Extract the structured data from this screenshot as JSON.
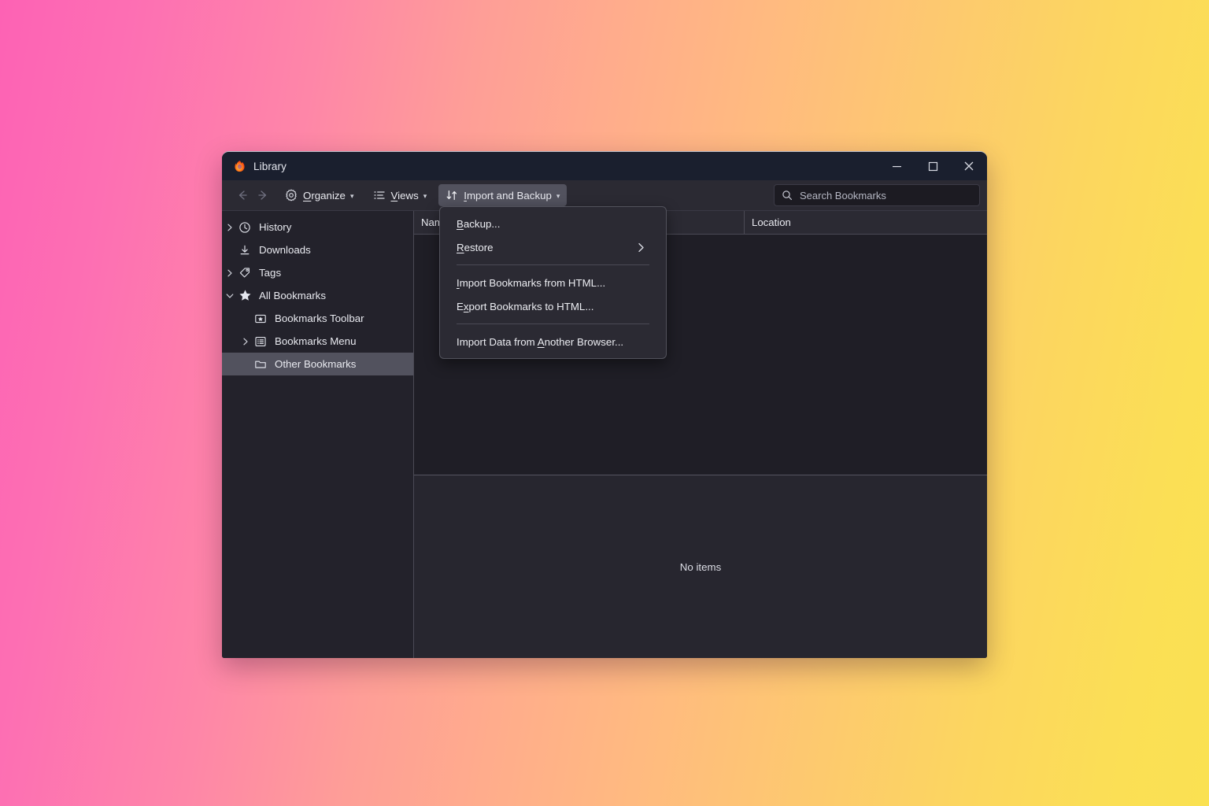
{
  "window": {
    "title": "Library",
    "logo_icon": "firefox-logo-icon",
    "controls": {
      "minimize_icon": "minimize-icon",
      "maximize_icon": "maximize-icon",
      "close_icon": "close-icon"
    }
  },
  "toolbar": {
    "back_icon": "back-arrow-icon",
    "forward_icon": "forward-arrow-icon",
    "buttons": [
      {
        "label": "Organize",
        "accesskey": "O",
        "icon": "gear-icon",
        "caret": "⌄",
        "active": false
      },
      {
        "label": "Views",
        "accesskey": "V",
        "icon": "list-view-icon",
        "caret": "⌄",
        "active": false
      },
      {
        "label": "Import and Backup",
        "accesskey": "I",
        "icon": "import-export-arrows-icon",
        "caret": "⌄",
        "active": true
      }
    ],
    "search": {
      "placeholder": "Search Bookmarks",
      "value": "",
      "icon": "search-icon"
    }
  },
  "sidebar": {
    "items": [
      {
        "label": "History",
        "icon": "clock-icon",
        "twisty": "collapsed",
        "indent": 0,
        "selected": false
      },
      {
        "label": "Downloads",
        "icon": "download-icon",
        "twisty": "none",
        "indent": 0,
        "selected": false
      },
      {
        "label": "Tags",
        "icon": "tag-icon",
        "twisty": "collapsed",
        "indent": 0,
        "selected": false
      },
      {
        "label": "All Bookmarks",
        "icon": "star-icon",
        "twisty": "expanded",
        "indent": 0,
        "selected": false
      },
      {
        "label": "Bookmarks Toolbar",
        "icon": "bookmarks-toolbar-icon",
        "twisty": "none",
        "indent": 1,
        "selected": false
      },
      {
        "label": "Bookmarks Menu",
        "icon": "bookmarks-menu-icon",
        "twisty": "collapsed",
        "indent": 1,
        "selected": false
      },
      {
        "label": "Other Bookmarks",
        "icon": "folder-icon",
        "twisty": "none",
        "indent": 1,
        "selected": true
      }
    ]
  },
  "content": {
    "columns": [
      "Name",
      "",
      "Location"
    ],
    "rows": [],
    "detail_empty_text": "No items"
  },
  "menu": {
    "open_for": "Import and Backup",
    "items": [
      {
        "type": "item",
        "label": "Backup...",
        "accesskey": "B",
        "submenu": false
      },
      {
        "type": "item",
        "label": "Restore",
        "accesskey": "R",
        "submenu": true,
        "submenu_icon": "chevron-right-icon"
      },
      {
        "type": "separator"
      },
      {
        "type": "item",
        "label": "Import Bookmarks from HTML...",
        "accesskey": "I",
        "submenu": false
      },
      {
        "type": "item",
        "label": "Export Bookmarks to HTML...",
        "accesskey": "x",
        "submenu": false
      },
      {
        "type": "separator"
      },
      {
        "type": "item",
        "label": "Import Data from Another Browser...",
        "accesskey": "A",
        "submenu": false
      }
    ]
  },
  "colors": {
    "titlebar": "#1a1f2e",
    "toolbar": "#2b2a33",
    "pane": "#23222b",
    "list": "#1f1e26",
    "selected_row": "#52525e",
    "menu_bg": "#2b2a33",
    "text": "#e9eaf0",
    "bg_gradient_start": "#fd62b4",
    "bg_gradient_mid": "#ffac8c",
    "bg_gradient_end": "#fae152"
  }
}
